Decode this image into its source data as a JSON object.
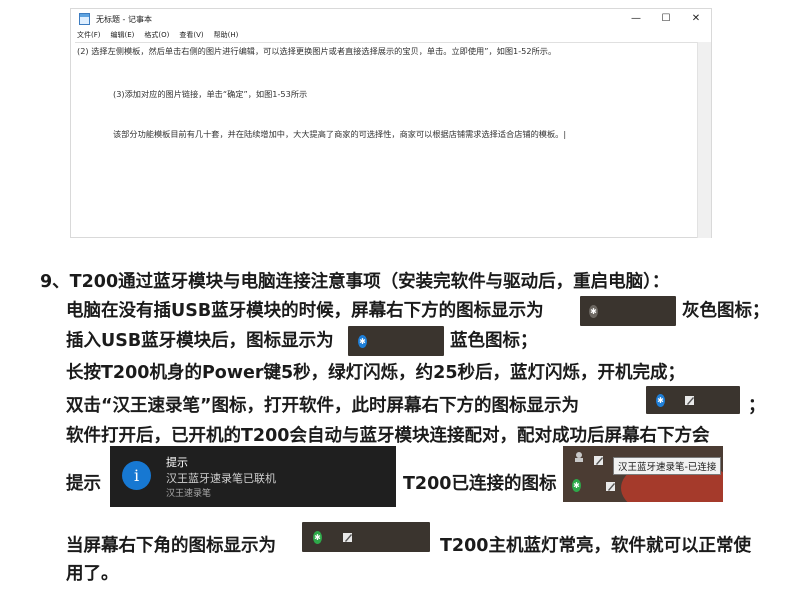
{
  "notepad": {
    "title": "无标题 - 记事本",
    "controls": {
      "minimize": "—",
      "maximize": "☐",
      "close": "✕"
    },
    "menu": [
      "文件(F)",
      "编辑(E)",
      "格式(O)",
      "查看(V)",
      "帮助(H)"
    ],
    "lines": [
      "(2) 选择左侧模板，然后单击右侧的图片进行编辑，可以选择更换图片或者直接选择展示的宝贝，单击。立即使用”，如图1-52所示。",
      "(3)添加对应的图片链接，单击“确定”，如图1-53所示",
      "该部分功能模板目前有几十套，并在陆续增加中，大大提高了商家的可选择性，商家可以根据店铺需求选择适合店铺的模板。|"
    ]
  },
  "doc": {
    "heading": "9、T200通过蓝牙模块与电脑连接注意事项（安装完软件与驱动后，重启电脑）：",
    "l1a": "电脑在没有插USB蓝牙模块的时候，屏幕右下方的图标显示为",
    "l1b": "灰色图标；",
    "l2a": "插入USB蓝牙模块后，图标显示为",
    "l2b": "蓝色图标；",
    "l3": "长按T200机身的Power键5秒，绿灯闪烁，约25秒后，蓝灯闪烁，开机完成；",
    "l4a": "双击“汉王速录笔”图标，打开软件，此时屏幕右下方的图标显示为",
    "l4b": "；",
    "l5": "软件打开后，已开机的T200会自动与蓝牙模块连接配对，配对成功后屏幕右下方会",
    "l6a": "提示",
    "l6b": "T200已连接的图标",
    "l7a": "当屏幕右下角的图标显示为",
    "l7b": "T200主机蓝灯常亮，软件就可以正常使",
    "l8": "用了。"
  },
  "toast": {
    "icon": "i",
    "title": "提示",
    "message": "汉王蓝牙速录笔已联机",
    "source": "汉王速录笔"
  },
  "tooltip": {
    "text": "汉王蓝牙速录笔-已连接"
  },
  "icons": {
    "bluetooth_glyph": "✱",
    "colors": {
      "gray": "#6d6862",
      "blue": "#1e7fd8",
      "green": "#2ea94a",
      "tray": "#3a342e"
    }
  }
}
